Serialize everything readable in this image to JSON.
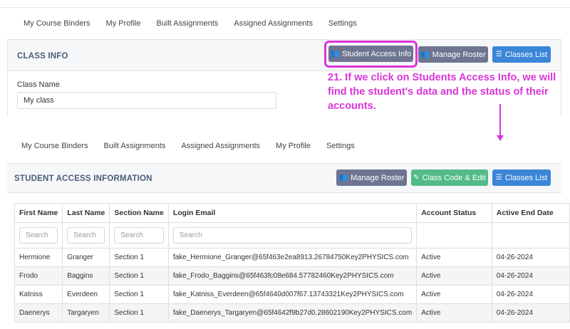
{
  "nav_top": [
    "My Course Binders",
    "My Profile",
    "Built Assignments",
    "Assigned Assignments",
    "Settings"
  ],
  "nav_bottom": [
    "My Course Binders",
    "Built Assignments",
    "Assigned Assignments",
    "My Profile",
    "Settings"
  ],
  "class_info": {
    "title": "CLASS INFO",
    "buttons": {
      "student_access": "Student Access Info",
      "manage_roster": "Manage Roster",
      "classes_list": "Classes List"
    },
    "class_name_label": "Class Name",
    "class_name_value": "My class"
  },
  "annotation": "21. If we click on Students Access Info, we will find the student's data and the status of their accounts.",
  "student_access": {
    "title": "STUDENT ACCESS INFORMATION",
    "buttons": {
      "manage_roster": "Manage Roster",
      "class_code": "Class Code & Edit",
      "classes_list": "Classes List"
    },
    "columns": [
      "First Name",
      "Last Name",
      "Section Name",
      "Login Email",
      "Account Status",
      "Active End Date"
    ],
    "search_placeholder": "Search",
    "rows": [
      [
        "Hermione",
        "Granger",
        "Section 1",
        "fake_Hermione_Granger@65f463e2ea8913.26784750Key2PHYSICS.com",
        "Active",
        "04-26-2024"
      ],
      [
        "Frodo",
        "Baggins",
        "Section 1",
        "fake_Frodo_Baggins@65f463fc08e684.57782460Key2PHYSICS.com",
        "Active",
        "04-26-2024"
      ],
      [
        "Katniss",
        "Everdeen",
        "Section 1",
        "fake_Katniss_Everdeen@65f4640d007f67.13743321Key2PHYSICS.com",
        "Active",
        "04-26-2024"
      ],
      [
        "Daenerys",
        "Targaryen",
        "Section 1",
        "fake_Daenerys_Targaryen@65f4642f9b27d0.28602190Key2PHYSICS.com",
        "Active",
        "04-26-2024"
      ]
    ]
  },
  "colors": {
    "accent_purple": "#6e7590",
    "blue": "#3b86d8",
    "green": "#52bb88",
    "annotation_magenta": "#d935d9"
  }
}
